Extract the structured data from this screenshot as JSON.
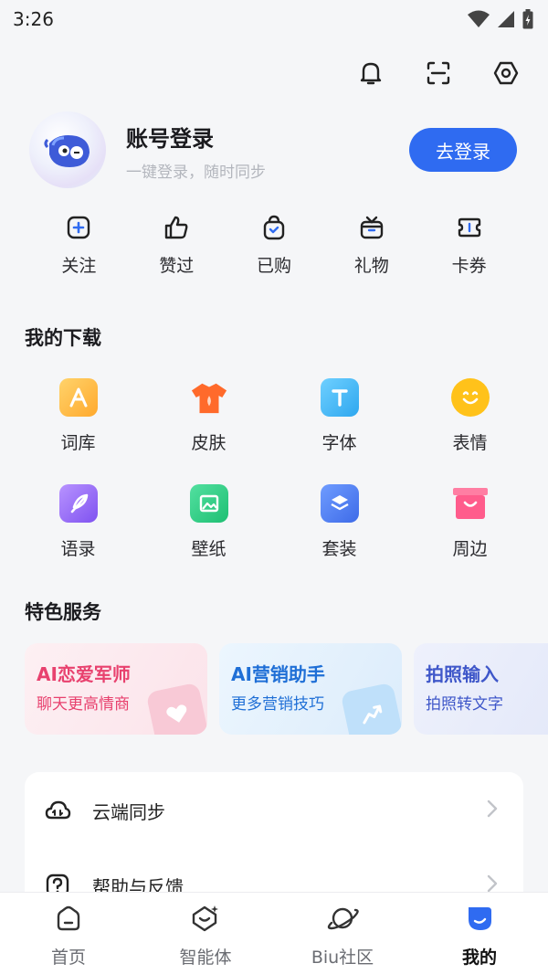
{
  "status_bar": {
    "time": "3:26"
  },
  "profile": {
    "title": "账号登录",
    "subtitle": "一键登录，随时同步",
    "login_button": "去登录"
  },
  "quick_actions": [
    {
      "label": "关注",
      "icon": "plus-square-icon"
    },
    {
      "label": "赞过",
      "icon": "thumbs-up-icon"
    },
    {
      "label": "已购",
      "icon": "purchased-bag-icon"
    },
    {
      "label": "礼物",
      "icon": "gift-icon"
    },
    {
      "label": "卡券",
      "icon": "ticket-icon"
    }
  ],
  "downloads": {
    "title": "我的下载",
    "items": [
      {
        "label": "词库",
        "icon": "dictionary-icon",
        "color": "#ffb23f"
      },
      {
        "label": "皮肤",
        "icon": "skin-shirt-icon",
        "color": "#ff6a2b"
      },
      {
        "label": "字体",
        "icon": "font-icon",
        "color": "#3ab6f5"
      },
      {
        "label": "表情",
        "icon": "emoji-icon",
        "color": "#ffc21a"
      },
      {
        "label": "语录",
        "icon": "quote-feather-icon",
        "color": "#9b6cf5"
      },
      {
        "label": "壁纸",
        "icon": "wallpaper-icon",
        "color": "#2fcf86"
      },
      {
        "label": "套装",
        "icon": "bundle-layers-icon",
        "color": "#4f7df3"
      },
      {
        "label": "周边",
        "icon": "merch-box-icon",
        "color": "#f25a8a"
      }
    ]
  },
  "services": {
    "title": "特色服务",
    "cards": [
      {
        "title": "AI恋爱军师",
        "subtitle": "聊天更高情商",
        "title_color": "#e8416e",
        "sub_color": "#e8416e",
        "bg": "#fdeef2"
      },
      {
        "title": "AI营销助手",
        "subtitle": "更多营销技巧",
        "title_color": "#1f6fd6",
        "sub_color": "#1f6fd6",
        "bg": "#e8f3fd"
      },
      {
        "title": "拍照输入",
        "subtitle": "拍照转文字",
        "title_color": "#3f57c9",
        "sub_color": "#3f57c9",
        "bg": "#ebeefb"
      }
    ]
  },
  "settings": [
    {
      "label": "云端同步",
      "icon": "cloud-sync-icon"
    },
    {
      "label": "帮助与反馈",
      "icon": "help-icon"
    }
  ],
  "bottom_nav": [
    {
      "label": "首页",
      "icon": "home-icon",
      "active": false
    },
    {
      "label": "智能体",
      "icon": "agent-icon",
      "active": false
    },
    {
      "label": "Biu社区",
      "icon": "planet-icon",
      "active": false
    },
    {
      "label": "我的",
      "icon": "me-icon",
      "active": true
    }
  ],
  "colors": {
    "accent": "#2f6bf1",
    "background": "#f5f6f8"
  }
}
